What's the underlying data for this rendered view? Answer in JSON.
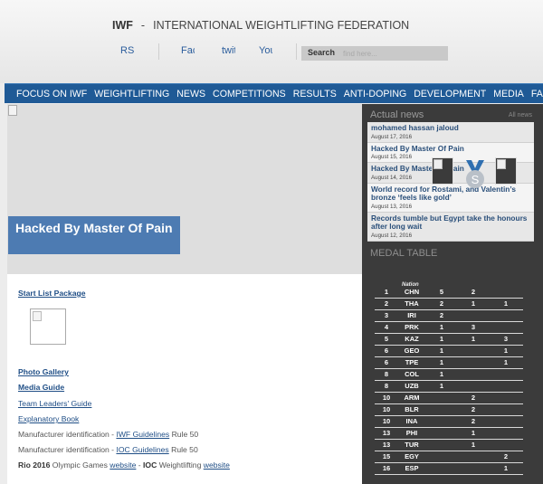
{
  "header": {
    "org_abbr": "IWF",
    "org_separator": "-",
    "org_name": "INTERNATIONAL WEIGHTLIFTING FEDERATION",
    "social": [
      "RS",
      "Fac",
      "twit",
      "You"
    ],
    "search_label": "Search",
    "search_placeholder": "find here..."
  },
  "nav": {
    "items": [
      "FOCUS ON IWF",
      "WEIGHTLIFTING",
      "NEWS",
      "COMPETITIONS",
      "RESULTS",
      "ANTI-DOPING",
      "DEVELOPMENT",
      "MEDIA",
      "FAQ"
    ]
  },
  "hero": {
    "caption": "Hacked By Master Of Pain"
  },
  "content": {
    "start_list": "Start List Package",
    "photo_gallery": "Photo Gallery",
    "media_guide": "Media Guide",
    "team_leaders_guide": "Team Leaders' Guide",
    "explanatory_book": "Explanatory Book",
    "manufacturer_1_prefix": "Manufacturer identification - ",
    "manufacturer_1_link": "IWF Guidelines",
    "manufacturer_1_suffix": " Rule 50",
    "manufacturer_2_prefix": "Manufacturer identification - ",
    "manufacturer_2_link": "IOC Guidelines",
    "manufacturer_2_suffix": " Rule 50",
    "rio_bold": "Rio 2016",
    "rio_text": " Olympic Games ",
    "rio_link": "website",
    "rio_dash": " - ",
    "ioc_bold": "IOC",
    "ioc_text": " Weightlifting ",
    "ioc_link": "website"
  },
  "news": {
    "title": "Actual news",
    "more": "All news",
    "items": [
      {
        "title": "mohamed hassan jaloud",
        "date": "August 17, 2016"
      },
      {
        "title": "Hacked By Master Of Pain",
        "date": "August 15, 2016"
      },
      {
        "title": "Hacked By Master Of Pain",
        "date": "August 14, 2016"
      },
      {
        "title": "World record for Rostami, and Valentin’s bronze ‘feels like gold’",
        "date": "August 13, 2016"
      },
      {
        "title": "Records tumble but Egypt take the honours after long wait",
        "date": "August 12, 2016"
      }
    ]
  },
  "medal_table": {
    "title": "MEDAL TABLE",
    "nation_header": "Nation",
    "silver_letter": "S",
    "medal_colors": {
      "silver": "#b9c0c8",
      "ribbon": "#2f6fb0"
    },
    "rows": [
      {
        "rank": "1",
        "nation": "CHN",
        "gold": "5",
        "silver": "2",
        "bronze": ""
      },
      {
        "rank": "2",
        "nation": "THA",
        "gold": "2",
        "silver": "1",
        "bronze": "1"
      },
      {
        "rank": "3",
        "nation": "IRI",
        "gold": "2",
        "silver": "",
        "bronze": ""
      },
      {
        "rank": "4",
        "nation": "PRK",
        "gold": "1",
        "silver": "3",
        "bronze": ""
      },
      {
        "rank": "5",
        "nation": "KAZ",
        "gold": "1",
        "silver": "1",
        "bronze": "3"
      },
      {
        "rank": "6",
        "nation": "GEO",
        "gold": "1",
        "silver": "",
        "bronze": "1"
      },
      {
        "rank": "6",
        "nation": "TPE",
        "gold": "1",
        "silver": "",
        "bronze": "1"
      },
      {
        "rank": "8",
        "nation": "COL",
        "gold": "1",
        "silver": "",
        "bronze": ""
      },
      {
        "rank": "8",
        "nation": "UZB",
        "gold": "1",
        "silver": "",
        "bronze": ""
      },
      {
        "rank": "10",
        "nation": "ARM",
        "gold": "",
        "silver": "2",
        "bronze": ""
      },
      {
        "rank": "10",
        "nation": "BLR",
        "gold": "",
        "silver": "2",
        "bronze": ""
      },
      {
        "rank": "10",
        "nation": "INA",
        "gold": "",
        "silver": "2",
        "bronze": ""
      },
      {
        "rank": "13",
        "nation": "PHI",
        "gold": "",
        "silver": "1",
        "bronze": ""
      },
      {
        "rank": "13",
        "nation": "TUR",
        "gold": "",
        "silver": "1",
        "bronze": ""
      },
      {
        "rank": "15",
        "nation": "EGY",
        "gold": "",
        "silver": "",
        "bronze": "2"
      },
      {
        "rank": "16",
        "nation": "ESP",
        "gold": "",
        "silver": "",
        "bronze": "1"
      }
    ]
  }
}
